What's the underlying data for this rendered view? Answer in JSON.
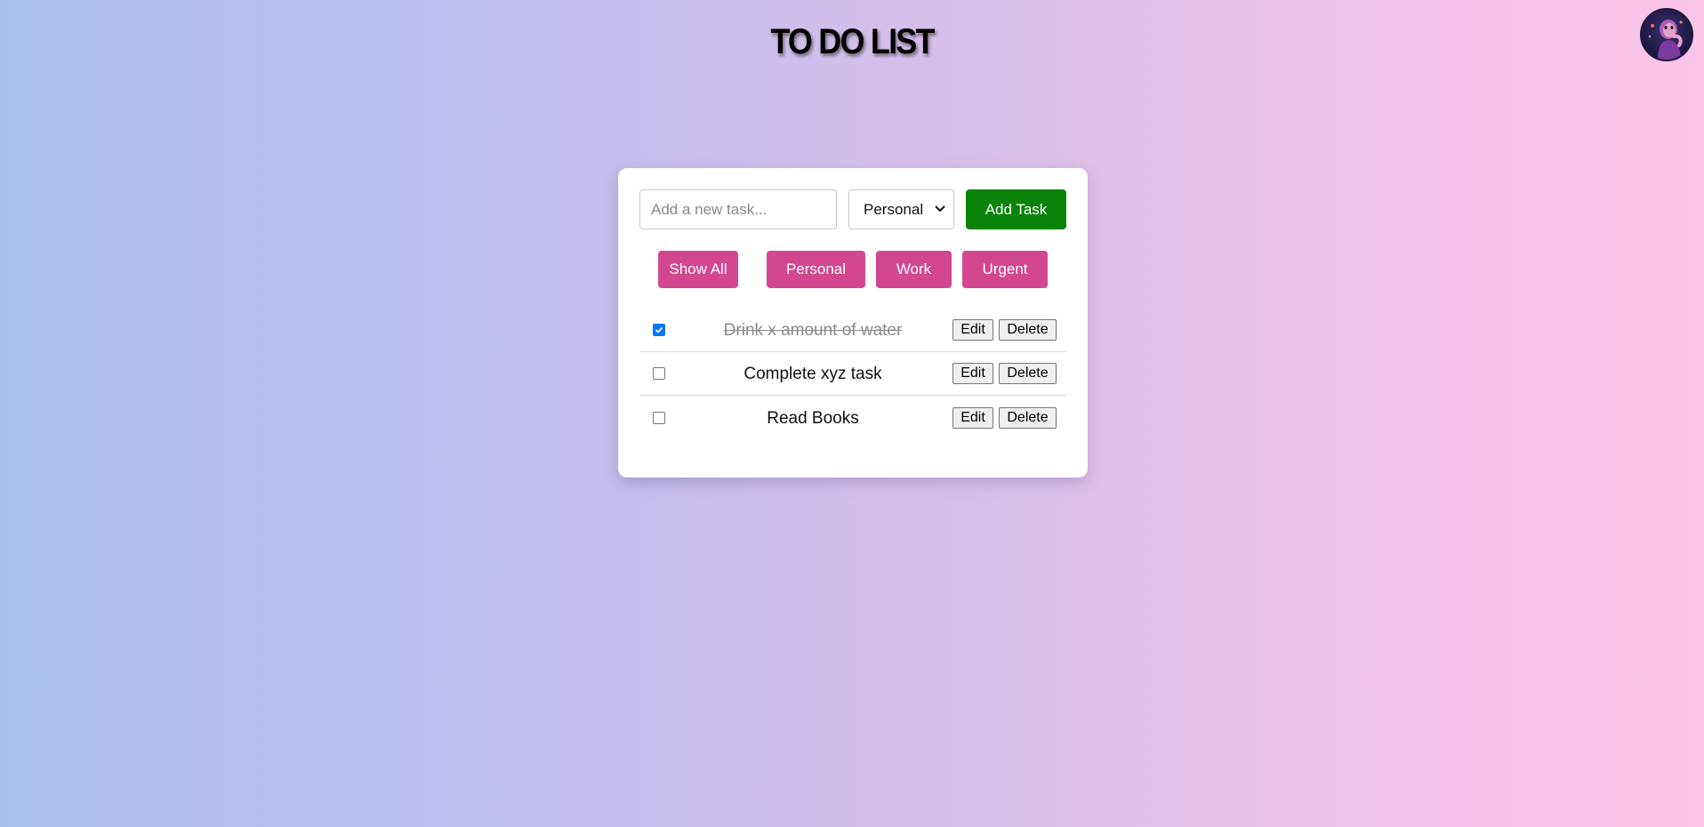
{
  "header": {
    "title": "TO DO LIST"
  },
  "form": {
    "input_placeholder": "Add a new task...",
    "input_value": "",
    "category_selected": "Personal",
    "add_label": "Add Task"
  },
  "filters": [
    {
      "label": "Show All"
    },
    {
      "label": "Personal"
    },
    {
      "label": "Work"
    },
    {
      "label": "Urgent"
    }
  ],
  "tasks": [
    {
      "text": "Drink x amount of water",
      "completed": true,
      "edit_label": "Edit",
      "delete_label": "Delete"
    },
    {
      "text": "Complete xyz task",
      "completed": false,
      "edit_label": "Edit",
      "delete_label": "Delete"
    },
    {
      "text": "Read Books",
      "completed": false,
      "edit_label": "Edit",
      "delete_label": "Delete"
    }
  ],
  "colors": {
    "add_button": "#0a8308",
    "filter_button": "#d24790",
    "checkbox_checked": "#0075ff"
  }
}
